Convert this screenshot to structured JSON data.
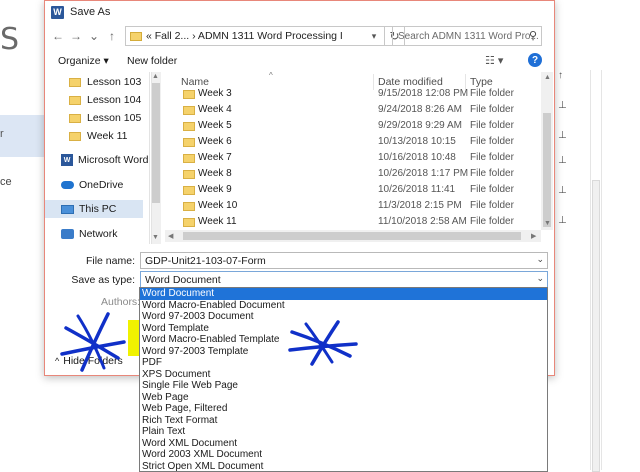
{
  "background": {
    "letter": "S",
    "item_r": "r",
    "item_ce": "ce",
    "pin_icons": [
      "pin-icon",
      "pin-icon",
      "pin-icon",
      "pin-icon",
      "pin-icon",
      "pin-icon"
    ]
  },
  "dialog": {
    "title": "Save As",
    "app_icon_letter": "W",
    "nav": {
      "back": "←",
      "forward": "→",
      "recent": "⌄",
      "up": "↑"
    },
    "address_crumbs": "« Fall 2...  ›  ADMN 1311 Word Processing I",
    "search_placeholder": "Search ADMN 1311 Word Pro...",
    "toolbar": {
      "organize": "Organize ▾",
      "new_folder": "New folder",
      "help": "?"
    },
    "navpane": {
      "items": [
        {
          "label": "Lesson 103",
          "icon": "folder-icon"
        },
        {
          "label": "Lesson 104",
          "icon": "folder-icon"
        },
        {
          "label": "Lesson 105",
          "icon": "folder-icon"
        },
        {
          "label": "Week 11",
          "icon": "folder-icon"
        },
        {
          "label": "Microsoft Word",
          "icon": "word-icon"
        },
        {
          "label": "OneDrive",
          "icon": "onedrive-icon"
        },
        {
          "label": "This PC",
          "icon": "pc-icon"
        },
        {
          "label": "Network",
          "icon": "network-icon"
        }
      ]
    },
    "columns": {
      "name": "Name",
      "date": "Date modified",
      "type": "Type"
    },
    "files": [
      {
        "name": "Week 3",
        "date": "9/15/2018 12:08 PM",
        "type": "File folder"
      },
      {
        "name": "Week 4",
        "date": "9/24/2018 8:26 AM",
        "type": "File folder"
      },
      {
        "name": "Week 5",
        "date": "9/29/2018 9:29 AM",
        "type": "File folder"
      },
      {
        "name": "Week 6",
        "date": "10/13/2018 10:15",
        "type": "File folder"
      },
      {
        "name": "Week 7",
        "date": "10/16/2018 10:48",
        "type": "File folder"
      },
      {
        "name": "Week 8",
        "date": "10/26/2018 1:17 PM",
        "type": "File folder"
      },
      {
        "name": "Week 9",
        "date": "10/26/2018 11:41",
        "type": "File folder"
      },
      {
        "name": "Week 10",
        "date": "11/3/2018 2:15 PM",
        "type": "File folder"
      },
      {
        "name": "Week 11",
        "date": "11/10/2018 2:58 AM",
        "type": "File folder"
      }
    ],
    "fields": {
      "file_name_label": "File name:",
      "file_name_value": "GDP-Unit21-103-07-Form",
      "save_as_type_label": "Save as type:",
      "save_as_type_value": "Word Document",
      "authors_label": "Authors:"
    },
    "hide_folders": "Hide Folders",
    "save_type_options": [
      "Word Document",
      "Word Macro-Enabled Document",
      "Word 97-2003 Document",
      "Word Template",
      "Word Macro-Enabled Template",
      "Word 97-2003 Template",
      "PDF",
      "XPS Document",
      "Single File Web Page",
      "Web Page",
      "Web Page, Filtered",
      "Rich Text Format",
      "Plain Text",
      "Word XML Document",
      "Word 2003 XML Document",
      "Strict Open XML Document"
    ],
    "selected_option_index": 0,
    "highlighted_option_indices": [
      3,
      4,
      5
    ]
  },
  "colors": {
    "highlight": "#f0f200",
    "annotation_ink": "#1030c8",
    "selection": "#1f73d8",
    "folder": "#f5d26b",
    "dialog_border": "#e8877a"
  }
}
